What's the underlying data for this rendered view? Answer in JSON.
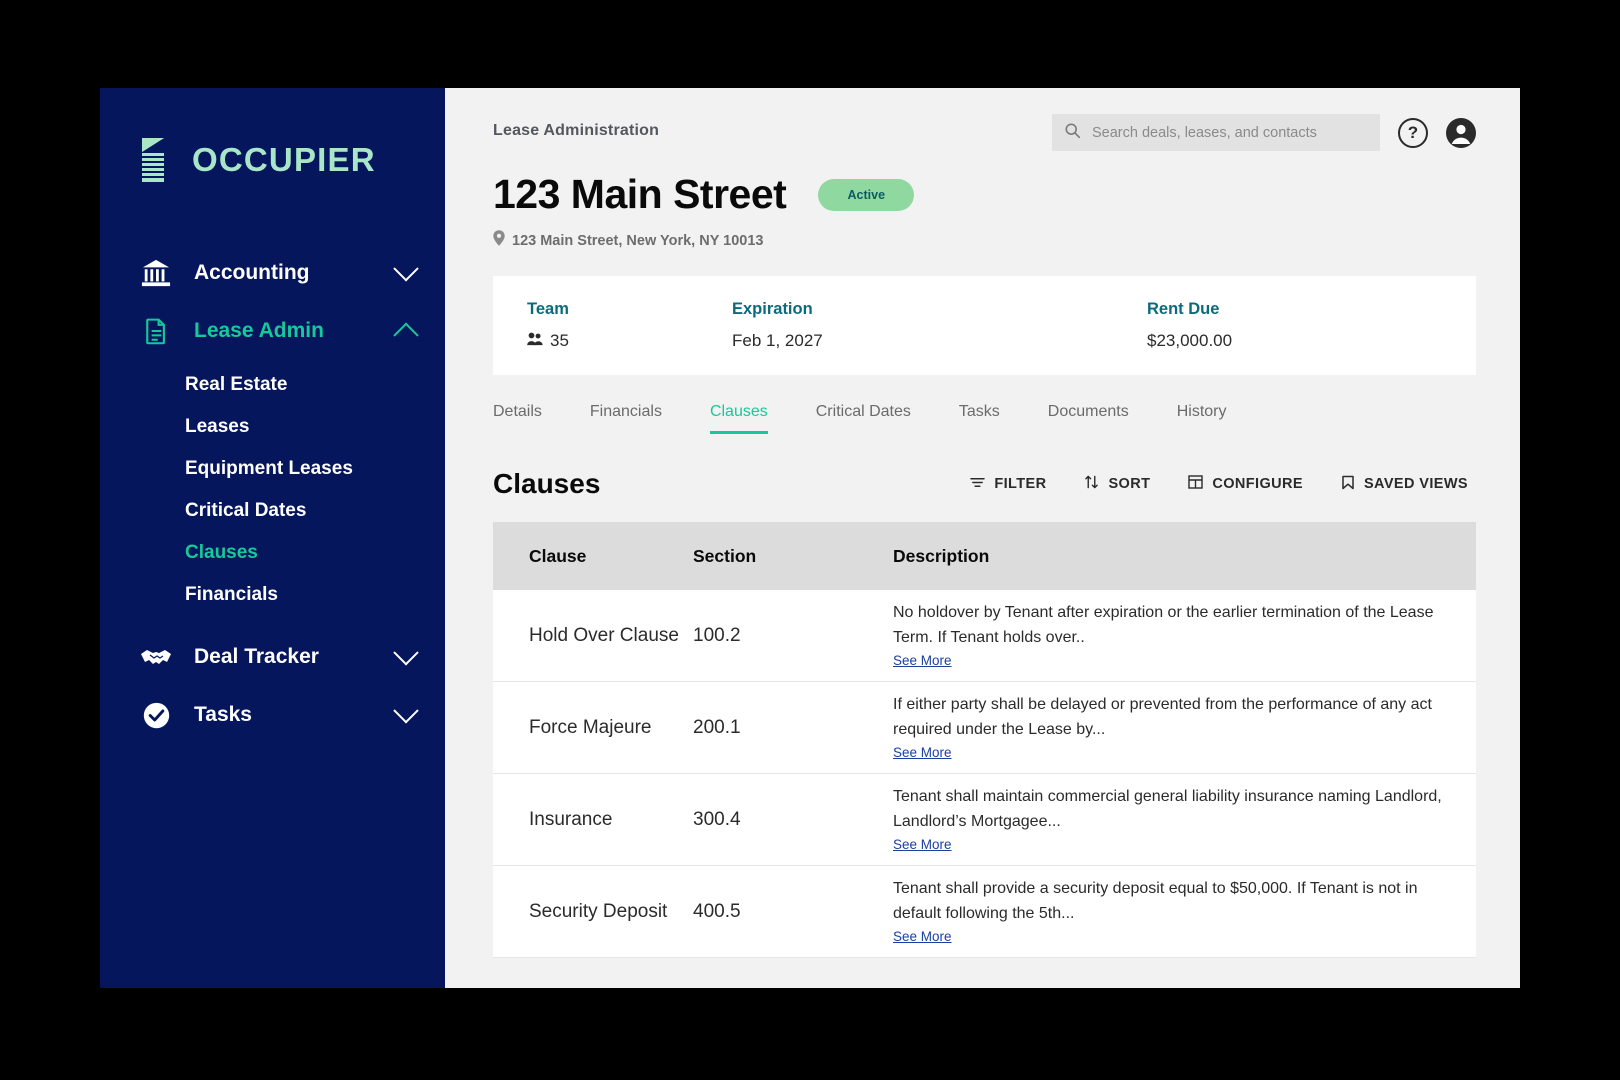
{
  "sidebar": {
    "logo_text": "OCCUPIER",
    "logo_icon": "document-pages-icon",
    "groups": [
      {
        "label": "Accounting",
        "icon": "bank-icon",
        "chevron": "chevron-down-icon",
        "expanded": false,
        "active": false
      },
      {
        "label": "Lease Admin",
        "icon": "document-icon",
        "chevron": "chevron-up-icon",
        "expanded": true,
        "active": true,
        "items": [
          {
            "label": "Real Estate",
            "selected": false
          },
          {
            "label": "Leases",
            "selected": false
          },
          {
            "label": "Equipment Leases",
            "selected": false
          },
          {
            "label": "Critical Dates",
            "selected": false
          },
          {
            "label": "Clauses",
            "selected": true
          },
          {
            "label": "Financials",
            "selected": false
          }
        ]
      },
      {
        "label": "Deal Tracker",
        "icon": "handshake-icon",
        "chevron": "chevron-down-icon",
        "expanded": false,
        "active": false
      },
      {
        "label": "Tasks",
        "icon": "check-circle-icon",
        "chevron": "chevron-down-icon",
        "expanded": false,
        "active": false
      }
    ]
  },
  "header": {
    "breadcrumb": "Lease Administration",
    "title": "123 Main Street",
    "status": "Active",
    "address": "123 Main Street, New York, NY 10013",
    "search_placeholder": "Search deals, leases, and contacts",
    "search_value": "",
    "help_label": "?"
  },
  "summary": {
    "team_label": "Team",
    "team_value": "35",
    "expiration_label": "Expiration",
    "expiration_value": "Feb 1, 2027",
    "rent_label": "Rent Due",
    "rent_value": "$23,000.00"
  },
  "tabs": [
    {
      "label": "Details",
      "active": false
    },
    {
      "label": "Financials",
      "active": false
    },
    {
      "label": "Clauses",
      "active": true
    },
    {
      "label": "Critical Dates",
      "active": false
    },
    {
      "label": "Tasks",
      "active": false
    },
    {
      "label": "Documents",
      "active": false
    },
    {
      "label": "History",
      "active": false
    }
  ],
  "section": {
    "title": "Clauses",
    "actions": [
      {
        "label": "FILTER",
        "icon": "filter-icon"
      },
      {
        "label": "SORT",
        "icon": "sort-arrows-icon"
      },
      {
        "label": "CONFIGURE",
        "icon": "grid-icon"
      },
      {
        "label": "SAVED VIEWS",
        "icon": "bookmark-icon"
      }
    ]
  },
  "table": {
    "columns": [
      "Clause",
      "Section",
      "Description"
    ],
    "see_more_label": "See More",
    "rows": [
      {
        "clause": "Hold Over Clause",
        "section": "100.2",
        "description": "No holdover by Tenant after expiration or the earlier termination of the Lease Term. If Tenant holds over.."
      },
      {
        "clause": "Force Majeure",
        "section": "200.1",
        "description": "If either party shall be delayed or prevented from the performance of any act required under the Lease by..."
      },
      {
        "clause": "Insurance",
        "section": "300.4",
        "description": "Tenant shall maintain commercial general liability insurance naming Landlord, Landlord’s Mortgagee..."
      },
      {
        "clause": "Security Deposit",
        "section": "400.5",
        "description": "Tenant shall provide a security deposit equal to $50,000. If Tenant is not in default following the 5th..."
      }
    ]
  },
  "colors": {
    "sidebar_bg": "#05165c",
    "accent_green": "#17c99a",
    "logo_green": "#a9e6c8",
    "teal_label": "#0b6b7d",
    "badge_bg": "#8fd9a0",
    "link_blue": "#1a3fa0"
  }
}
